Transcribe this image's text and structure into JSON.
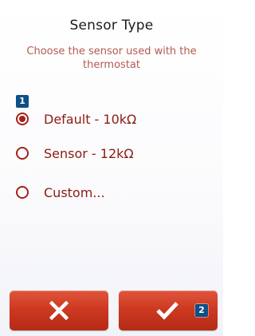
{
  "header": {
    "title": "Sensor Type",
    "subtitle": "Choose the sensor used with the thermostat"
  },
  "options": [
    {
      "label": "Default - 10kΩ",
      "selected": true
    },
    {
      "label": "Sensor - 12kΩ",
      "selected": false
    },
    {
      "label": "Custom...",
      "selected": false
    }
  ],
  "badges": {
    "step1": "1",
    "step2": "2"
  },
  "buttons": {
    "cancel_icon": "close-icon",
    "confirm_icon": "checkmark-icon"
  },
  "colors": {
    "accent": "#a3221b",
    "button_red": "#cd3a21",
    "badge_blue": "#0e4f86",
    "subtitle": "#b35a50"
  }
}
